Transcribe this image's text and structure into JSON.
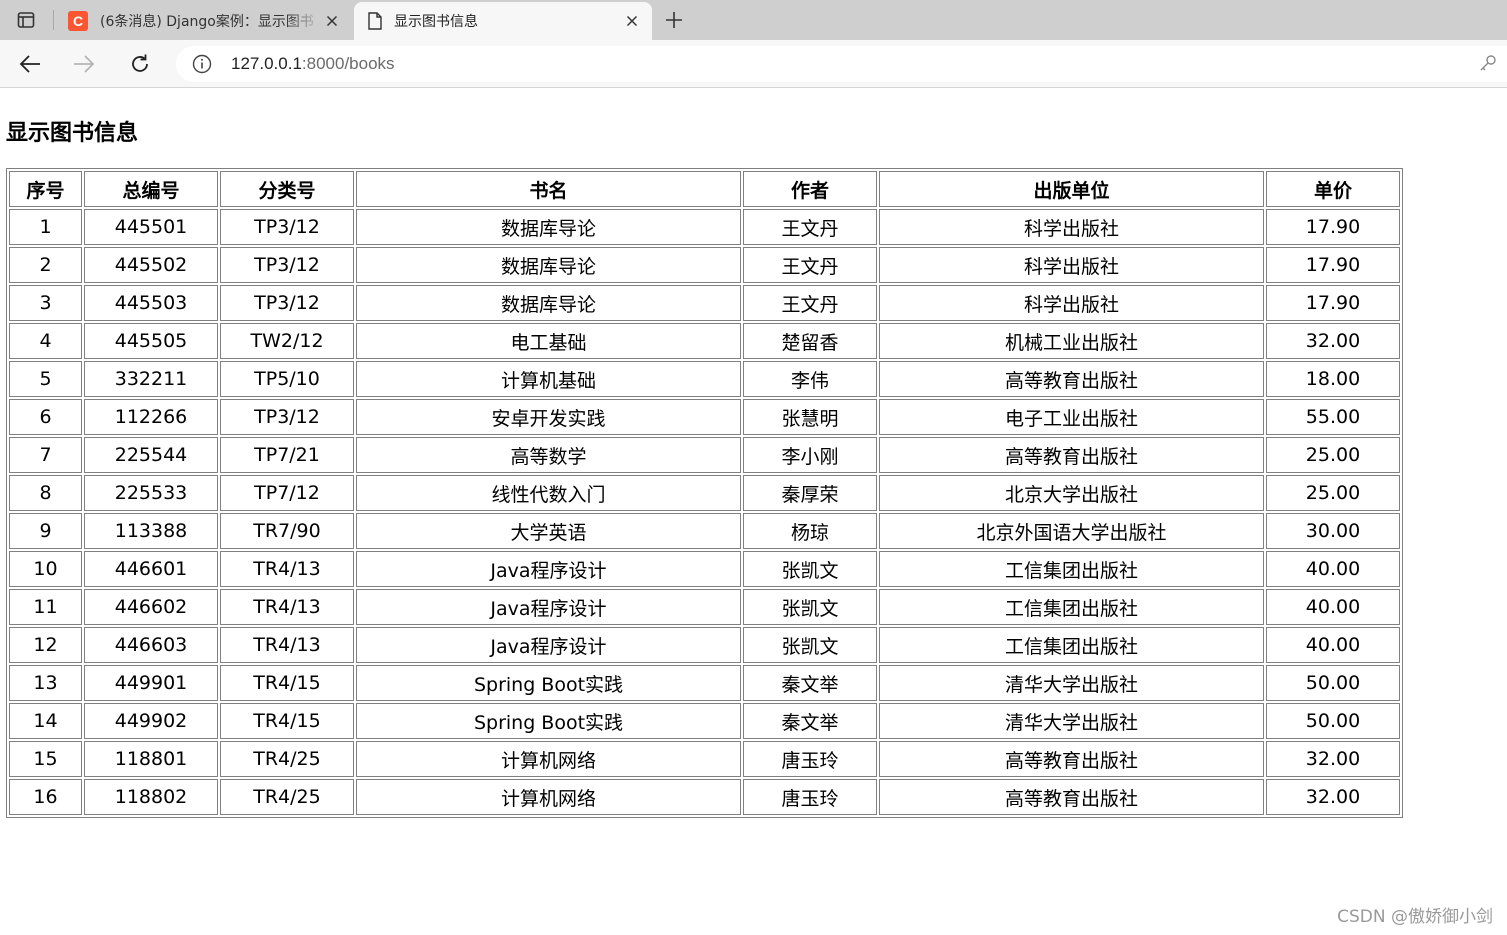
{
  "browser": {
    "tabs": [
      {
        "title": "(6条消息) Django案例：显示图书",
        "favicon": "csdn-logo",
        "active": false
      },
      {
        "title": "显示图书信息",
        "favicon": "page-icon",
        "active": true
      }
    ],
    "address": {
      "host": "127.0.0.1",
      "path": ":8000/books"
    }
  },
  "page": {
    "heading": "显示图书信息",
    "table": {
      "headers": [
        "序号",
        "总编号",
        "分类号",
        "书名",
        "作者",
        "出版单位",
        "单价"
      ],
      "rows": [
        [
          "1",
          "445501",
          "TP3/12",
          "数据库导论",
          "王文丹",
          "科学出版社",
          "17.90"
        ],
        [
          "2",
          "445502",
          "TP3/12",
          "数据库导论",
          "王文丹",
          "科学出版社",
          "17.90"
        ],
        [
          "3",
          "445503",
          "TP3/12",
          "数据库导论",
          "王文丹",
          "科学出版社",
          "17.90"
        ],
        [
          "4",
          "445505",
          "TW2/12",
          "电工基础",
          "楚留香",
          "机械工业出版社",
          "32.00"
        ],
        [
          "5",
          "332211",
          "TP5/10",
          "计算机基础",
          "李伟",
          "高等教育出版社",
          "18.00"
        ],
        [
          "6",
          "112266",
          "TP3/12",
          "安卓开发实践",
          "张慧明",
          "电子工业出版社",
          "55.00"
        ],
        [
          "7",
          "225544",
          "TP7/21",
          "高等数学",
          "李小刚",
          "高等教育出版社",
          "25.00"
        ],
        [
          "8",
          "225533",
          "TP7/12",
          "线性代数入门",
          "秦厚荣",
          "北京大学出版社",
          "25.00"
        ],
        [
          "9",
          "113388",
          "TR7/90",
          "大学英语",
          "杨琼",
          "北京外国语大学出版社",
          "30.00"
        ],
        [
          "10",
          "446601",
          "TR4/13",
          "Java程序设计",
          "张凯文",
          "工信集团出版社",
          "40.00"
        ],
        [
          "11",
          "446602",
          "TR4/13",
          "Java程序设计",
          "张凯文",
          "工信集团出版社",
          "40.00"
        ],
        [
          "12",
          "446603",
          "TR4/13",
          "Java程序设计",
          "张凯文",
          "工信集团出版社",
          "40.00"
        ],
        [
          "13",
          "449901",
          "TR4/15",
          "Spring Boot实践",
          "秦文举",
          "清华大学出版社",
          "50.00"
        ],
        [
          "14",
          "449902",
          "TR4/15",
          "Spring Boot实践",
          "秦文举",
          "清华大学出版社",
          "50.00"
        ],
        [
          "15",
          "118801",
          "TR4/25",
          "计算机网络",
          "唐玉玲",
          "高等教育出版社",
          "32.00"
        ],
        [
          "16",
          "118802",
          "TR4/25",
          "计算机网络",
          "唐玉玲",
          "高等教育出版社",
          "32.00"
        ]
      ]
    }
  },
  "watermark": "CSDN @傲娇御小剑",
  "colors": {
    "tabstrip": "#cfcfcf",
    "toolbar": "#f7f7f7",
    "csdn_brand": "#fc5531",
    "table_border": "#808080"
  }
}
